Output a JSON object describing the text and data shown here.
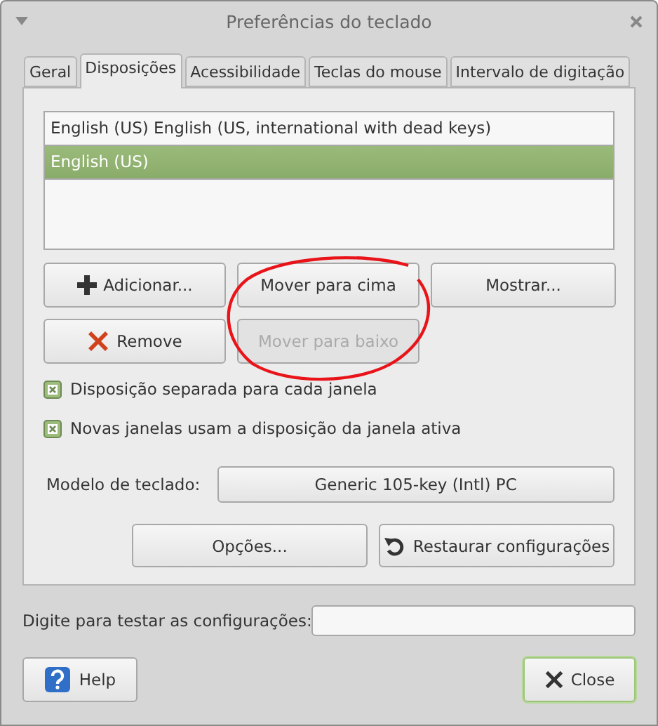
{
  "window": {
    "title": "Preferências do teclado"
  },
  "tabs": [
    {
      "label": "Geral",
      "selected": false
    },
    {
      "label": "Disposições",
      "selected": true
    },
    {
      "label": "Acessibilidade",
      "selected": false
    },
    {
      "label": "Teclas do mouse",
      "selected": false
    },
    {
      "label": "Intervalo de digitação",
      "selected": false
    }
  ],
  "layouts": [
    {
      "label": "English (US) English (US, international with dead keys)",
      "selected": false
    },
    {
      "label": "English (US)",
      "selected": true
    }
  ],
  "layout_buttons": [
    {
      "label": "Adicionar...",
      "kind": "add",
      "disabled": false
    },
    {
      "label": "Mover para cima",
      "kind": "plain",
      "disabled": false
    },
    {
      "label": "Mostrar...",
      "kind": "plain",
      "disabled": false
    },
    {
      "label": "Remove",
      "kind": "remove",
      "disabled": false
    },
    {
      "label": "Mover para baixo",
      "kind": "plain",
      "disabled": true
    }
  ],
  "options": [
    {
      "label": "Disposição separada para cada janela",
      "checked": true
    },
    {
      "label": "Novas janelas usam a disposição da janela ativa",
      "checked": true
    }
  ],
  "keyboard_model": {
    "label": "Modelo de teclado:",
    "value": "Generic 105-key (Intl) PC"
  },
  "actions": [
    {
      "label": "Opções...",
      "kind": "plain"
    },
    {
      "label": "Restaurar configurações",
      "kind": "reset"
    }
  ],
  "test": {
    "label": "Digite para testar as configurações:"
  },
  "footer_buttons": [
    {
      "label": "Help",
      "kind": "help",
      "focused": false
    },
    {
      "label": "Close",
      "kind": "close",
      "focused": true
    }
  ]
}
